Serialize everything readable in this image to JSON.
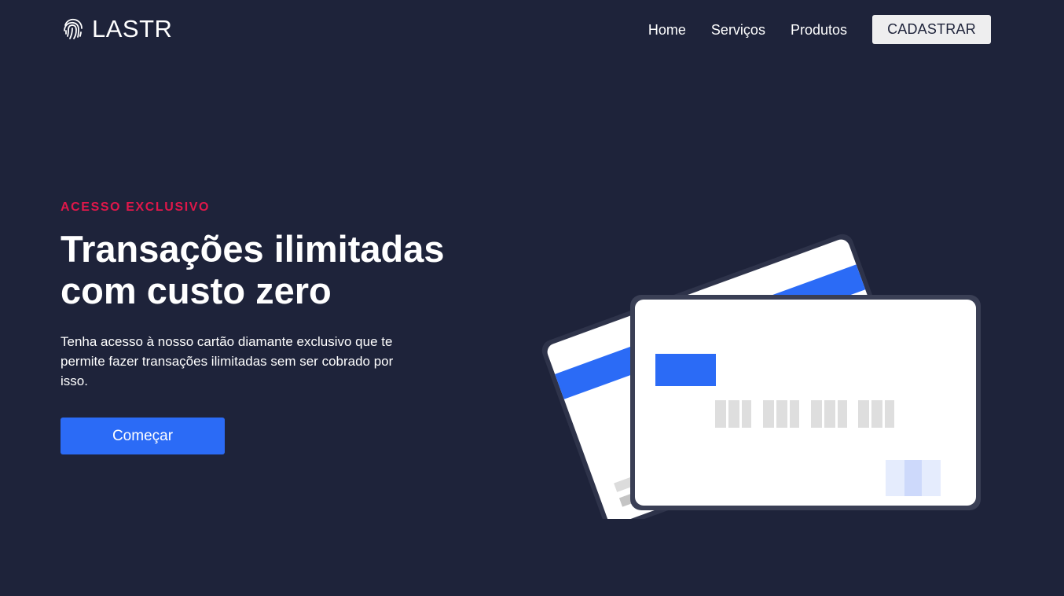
{
  "header": {
    "brand": "LASTR",
    "nav": [
      {
        "label": "Home"
      },
      {
        "label": "Serviços"
      },
      {
        "label": "Produtos"
      }
    ],
    "cta_label": "CADASTRAR"
  },
  "hero": {
    "eyebrow": "ACESSO EXCLUSIVO",
    "headline_line1": "Transações ilimitadas",
    "headline_line2": "com custo zero",
    "description": "Tenha acesso à nosso cartão diamante exclusivo que te permite fazer transações ilimitadas sem ser cobrado por isso.",
    "cta_label": "Começar"
  },
  "theme": {
    "background": "#1e233a",
    "accent": "#e0174a",
    "primary": "#2b6bf6",
    "cta_light": "#eeeeef"
  },
  "icons": {
    "brand": "fingerprint-icon"
  }
}
